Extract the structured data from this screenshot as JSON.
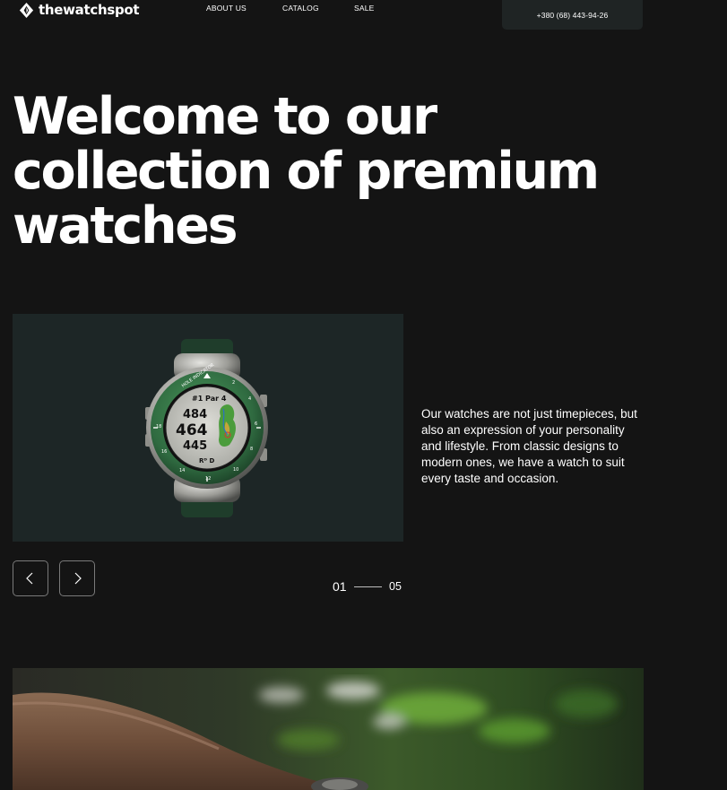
{
  "header": {
    "logo_text": "thewatchspot",
    "nav": [
      "ABOUT US",
      "CATALOG",
      "SALE"
    ],
    "phone": "+380 (68) 443-94-26"
  },
  "hero": {
    "title_lines": [
      "Welcome to our",
      "collection of premium",
      "watches"
    ]
  },
  "slider": {
    "watch_face": {
      "top_label": "#1 Par 4",
      "values": [
        "484",
        "464",
        "445"
      ],
      "bottom_label": "D",
      "bezel_label": "HOLE INDICATOR",
      "bezel_numbers": [
        "2",
        "4",
        "6",
        "8",
        "10",
        "12",
        "14",
        "16",
        "18"
      ]
    },
    "description": "Our watches are not just timepieces, but also an expression of your personality and lifestyle. From classic designs to modern ones, we have a watch to suit every taste and occasion.",
    "current": "01",
    "total": "05"
  },
  "colors": {
    "background": "#141414",
    "slide_background": "#1d2626",
    "phone_box": "#1f2424",
    "watch_bezel": "#2f6a40"
  },
  "icons": {
    "logo": "diamond-logo-icon",
    "prev": "chevron-left-icon",
    "next": "chevron-right-icon"
  }
}
